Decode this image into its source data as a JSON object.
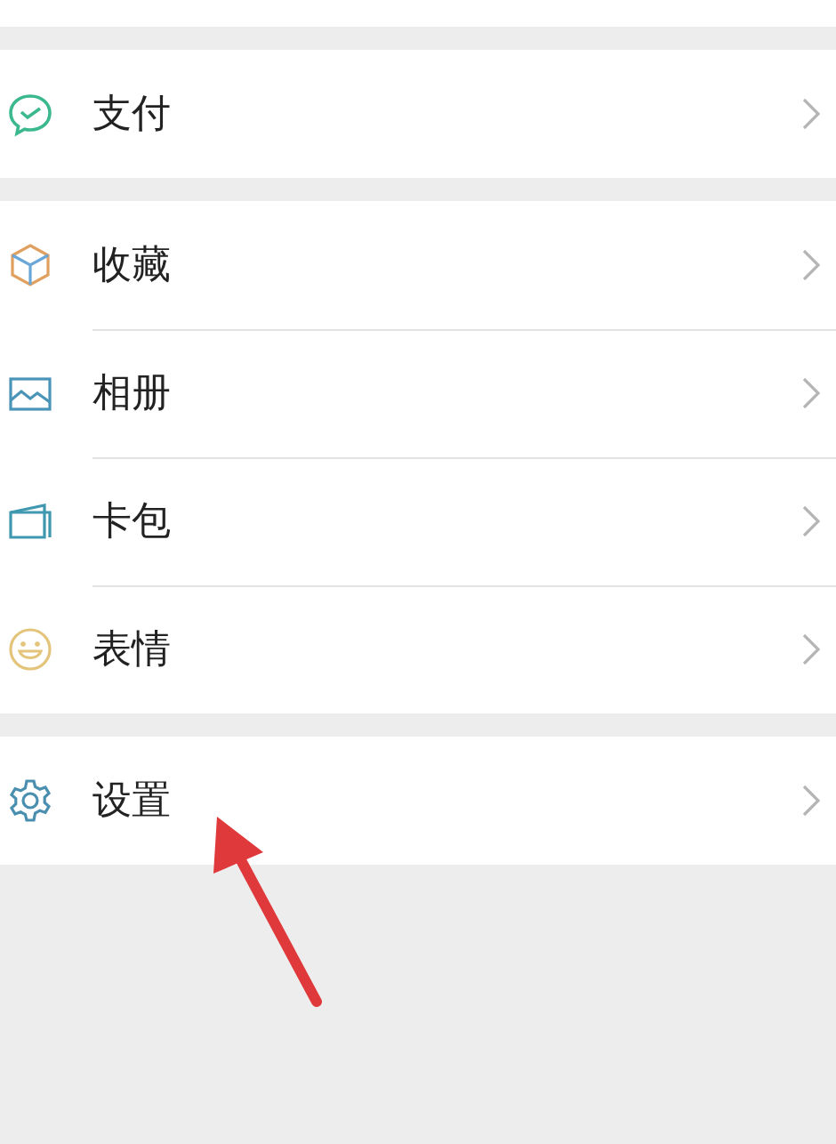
{
  "groups": [
    {
      "items": [
        {
          "kind": "pay",
          "label": "支付"
        }
      ]
    },
    {
      "items": [
        {
          "kind": "favorites",
          "label": "收藏"
        },
        {
          "kind": "album",
          "label": "相册"
        },
        {
          "kind": "cards",
          "label": "卡包"
        },
        {
          "kind": "stickers",
          "label": "表情"
        }
      ]
    },
    {
      "items": [
        {
          "kind": "settings",
          "label": "设置"
        }
      ]
    }
  ]
}
